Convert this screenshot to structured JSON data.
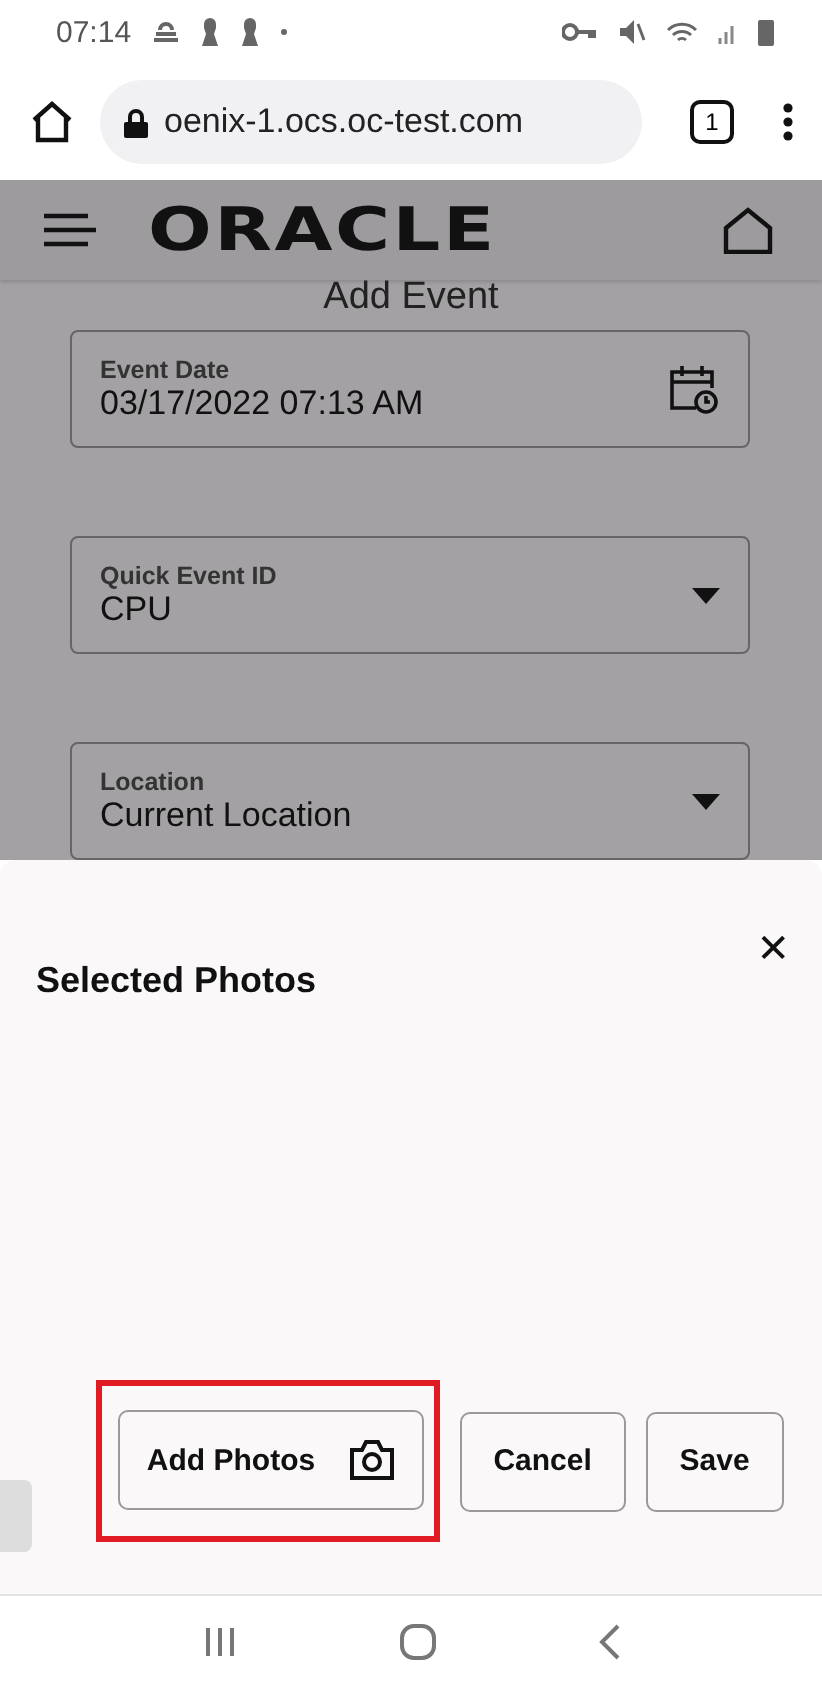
{
  "status_bar": {
    "time": "07:14"
  },
  "browser": {
    "url": "oenix-1.ocs.oc-test.com",
    "tab_count": "1"
  },
  "app": {
    "logo": "ORACLE",
    "title": "Add Event",
    "fields": [
      {
        "kind": "date",
        "label": "Event Date",
        "value": "03/17/2022 07:13 AM"
      },
      {
        "kind": "select",
        "label": "Quick Event ID",
        "value": "CPU"
      },
      {
        "kind": "select",
        "label": "Location",
        "value": "Current Location"
      }
    ]
  },
  "sheet": {
    "title": "Selected Photos",
    "close": "✕",
    "buttons": [
      {
        "label": "Add Photos",
        "kind": "photo",
        "highlighted": true
      },
      {
        "label": "Cancel",
        "kind": "plain",
        "highlighted": false
      },
      {
        "label": "Save",
        "kind": "plain",
        "highlighted": false
      }
    ]
  }
}
